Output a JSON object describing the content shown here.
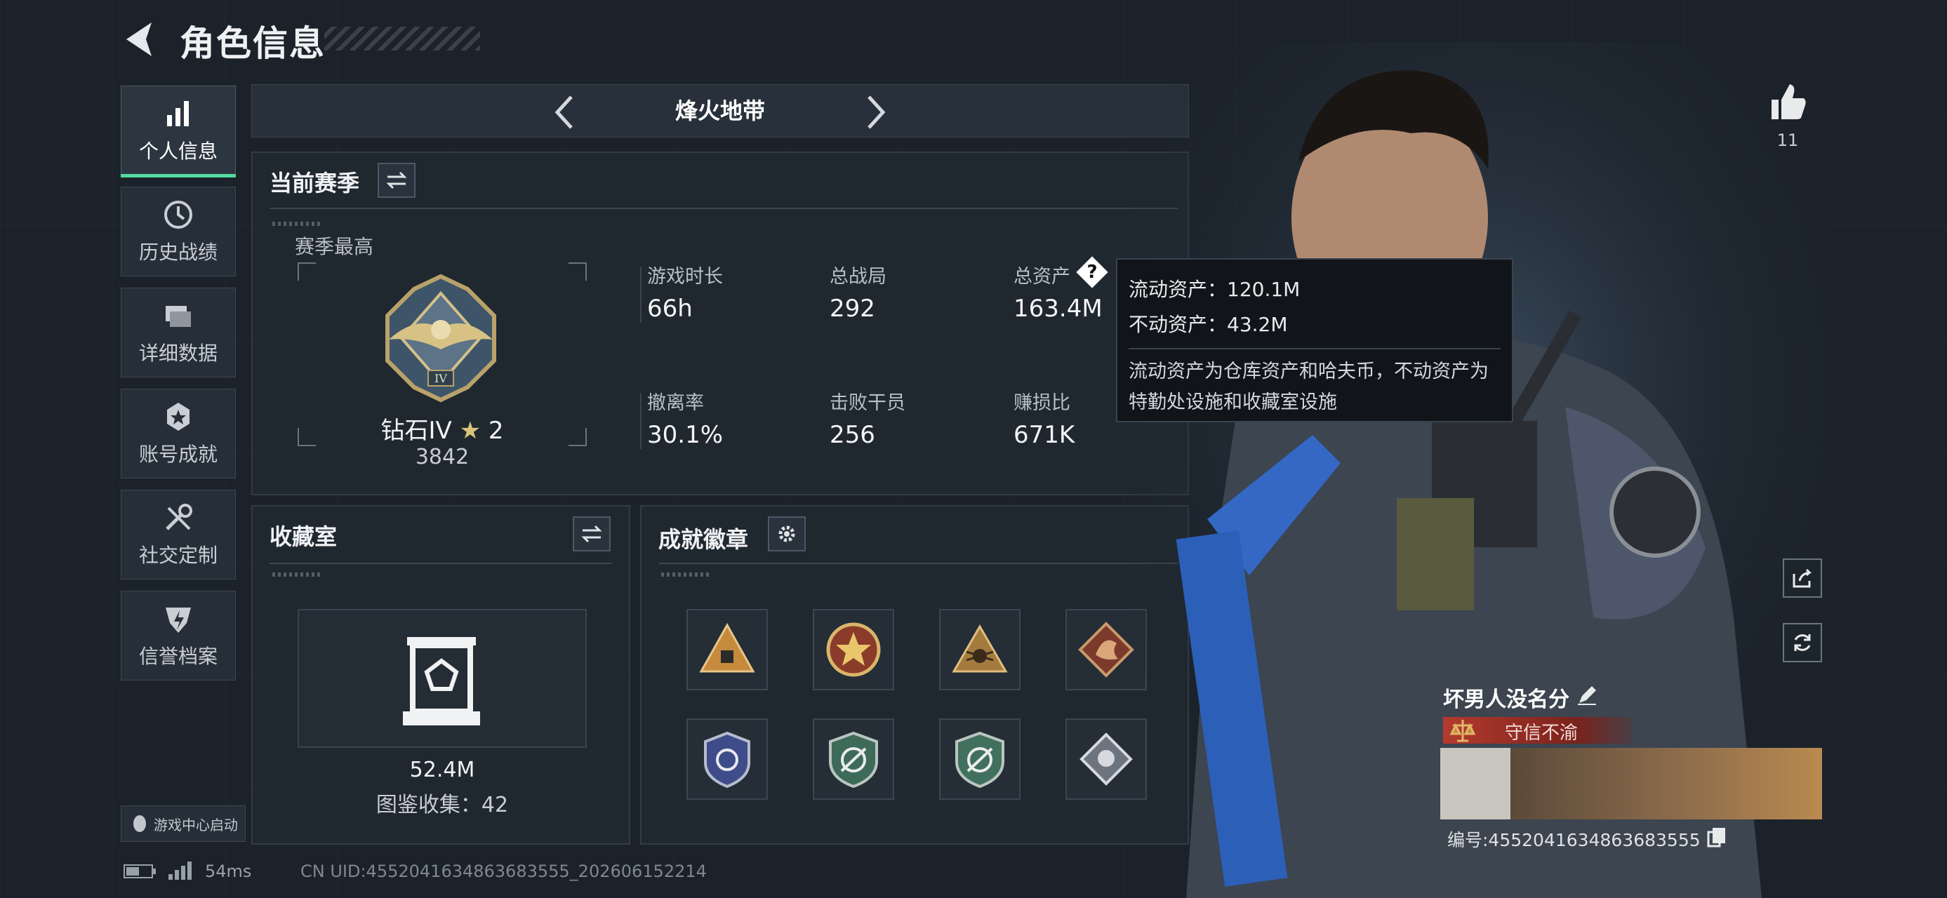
{
  "header": {
    "title": "角色信息"
  },
  "sidebar": {
    "items": [
      {
        "label": "个人信息",
        "icon": "bar-chart-icon",
        "active": true
      },
      {
        "label": "历史战绩",
        "icon": "history-icon",
        "active": false
      },
      {
        "label": "详细数据",
        "icon": "folder-icon",
        "active": false
      },
      {
        "label": "账号成就",
        "icon": "achievement-icon",
        "active": false
      },
      {
        "label": "社交定制",
        "icon": "tools-icon",
        "active": false
      },
      {
        "label": "信誉档案",
        "icon": "credit-shield-icon",
        "active": false
      }
    ],
    "launch_label": "游戏中心启动"
  },
  "mode": {
    "name": "烽火地带"
  },
  "season": {
    "title": "当前赛季",
    "best_label": "赛季最高",
    "rank_name": "钻石IV",
    "rank_stars": "2",
    "rank_score": "3842",
    "stats": [
      {
        "label": "游戏时长",
        "value": "66h"
      },
      {
        "label": "总战局",
        "value": "292"
      },
      {
        "label": "总资产",
        "value": "163.4M"
      },
      {
        "label": "撤离率",
        "value": "30.1%"
      },
      {
        "label": "击败干员",
        "value": "256"
      },
      {
        "label": "赚损比",
        "value": "671K"
      }
    ]
  },
  "tooltip": {
    "liquid": "流动资产：120.1M",
    "fixed": "不动资产：43.2M",
    "note": "流动资产为仓库资产和哈夫币，不动资产为特勤处设施和收藏室设施"
  },
  "collection": {
    "title": "收藏室",
    "value": "52.4M",
    "count_text": "图鉴收集：42"
  },
  "badges": {
    "title": "成就徽章"
  },
  "profile": {
    "likes": "11",
    "player_name": "坏男人没名分",
    "credit_title": "守信不渝",
    "id_text": "编号:4552041634863683555"
  },
  "status": {
    "ping": "54ms",
    "uid": "CN UID:4552041634863683555_202606152214"
  },
  "colors": {
    "accent": "#54d9a0",
    "credit_red": "#9a2a22",
    "panel": "#1f272f"
  }
}
